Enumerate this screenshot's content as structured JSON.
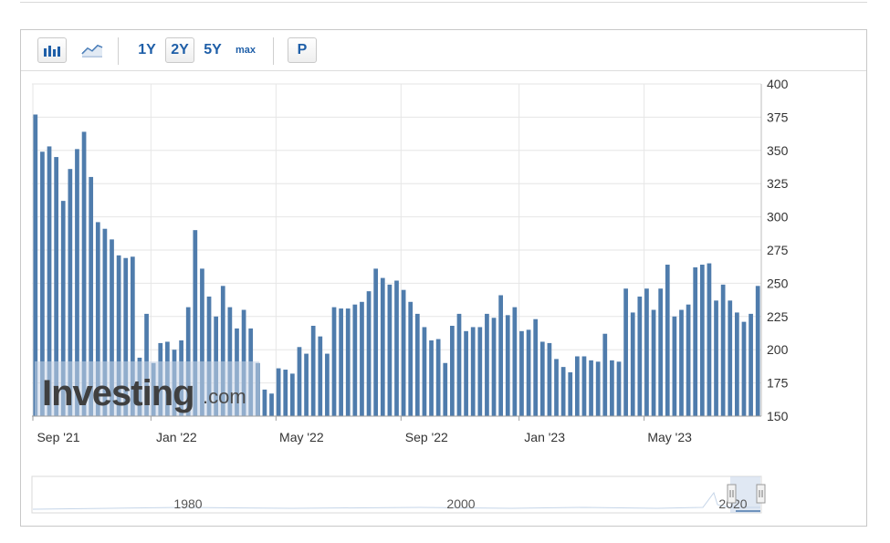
{
  "toolbar": {
    "bar_icon": "bar-chart-icon",
    "line_icon": "line-chart-icon",
    "range_1y": "1Y",
    "range_2y": "2Y",
    "range_5y": "5Y",
    "range_max": "max",
    "print_label": "P",
    "active_range": "2Y"
  },
  "watermark": {
    "brand": "Investing",
    "suffix": ".com"
  },
  "navigator": {
    "labels": [
      "1980",
      "2000",
      "2020"
    ]
  },
  "colors": {
    "bar": "#4f7cac",
    "grid": "#e6e6e6",
    "accent": "#1f5fa8"
  },
  "chart_data": {
    "type": "bar",
    "title": "",
    "xlabel": "",
    "ylabel": "",
    "ylim": [
      150,
      400
    ],
    "yticks": [
      150,
      175,
      200,
      225,
      250,
      275,
      300,
      325,
      350,
      375,
      400
    ],
    "y_axis_position": "right",
    "grid": true,
    "xtick_labels": [
      "Sep '21",
      "Jan '22",
      "May '22",
      "Sep '22",
      "Jan '23",
      "May '23"
    ],
    "values": [
      377,
      349,
      353,
      345,
      312,
      336,
      351,
      364,
      330,
      296,
      291,
      283,
      271,
      269,
      270,
      194,
      227,
      190,
      205,
      206,
      200,
      207,
      232,
      290,
      261,
      240,
      225,
      248,
      232,
      216,
      230,
      216,
      190,
      170,
      167,
      186,
      185,
      182,
      202,
      197,
      218,
      210,
      197,
      232,
      231,
      231,
      234,
      236,
      244,
      261,
      254,
      249,
      252,
      245,
      236,
      227,
      217,
      207,
      208,
      190,
      218,
      227,
      214,
      217,
      217,
      227,
      224,
      241,
      226,
      232,
      214,
      215,
      223,
      206,
      205,
      193,
      187,
      183,
      195,
      195,
      192,
      191,
      212,
      192,
      191,
      246,
      228,
      240,
      246,
      230,
      246,
      264,
      225,
      230,
      234,
      262,
      264,
      265,
      237,
      249,
      237,
      228,
      221,
      227,
      248
    ]
  }
}
